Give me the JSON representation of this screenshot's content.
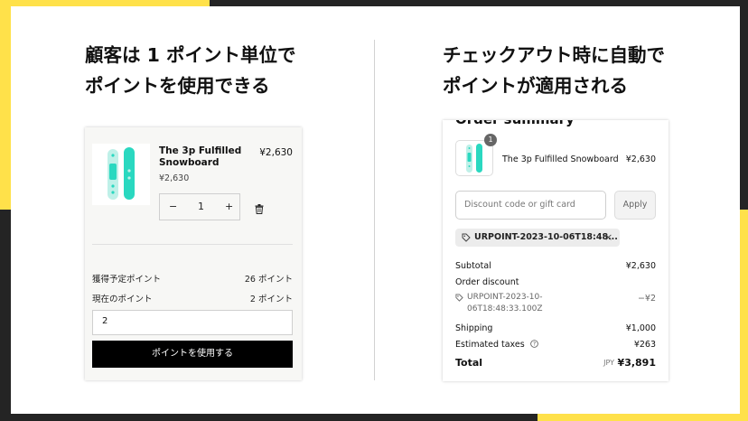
{
  "colors": {
    "accent": "#ffe14a",
    "dark_bg": "#242424",
    "board": "#2ad8c0",
    "button": "#000000"
  },
  "headings": {
    "left_line1": "顧客は 1 ポイント単位で",
    "left_line2": "ポイントを使用できる",
    "right_line1": "チェックアウト時に自動で",
    "right_line2": "ポイントが適用される"
  },
  "cart": {
    "product_title_line1": "The 3p Fulfilled",
    "product_title_line2": "Snowboard",
    "price": "¥2,630",
    "unit_price": "¥2,630",
    "quantity": "1",
    "minus": "−",
    "plus": "+",
    "points": [
      {
        "label": "獲得予定ポイント",
        "value": "26 ポイント"
      },
      {
        "label": "現在のポイント",
        "value": "2 ポイント"
      }
    ],
    "points_input_value": "2",
    "use_points_button": "ポイントを使用する"
  },
  "order": {
    "title": "Order summary",
    "item_count": "1",
    "product_name": "The 3p Fulfilled Snowboard",
    "product_price": "¥2,630",
    "discount_placeholder": "Discount code or gift card",
    "apply_label": "Apply",
    "applied_tag": "URPOINT-2023-10-06T18:48...",
    "subtotal_label": "Subtotal",
    "subtotal_value": "¥2,630",
    "order_discount_label": "Order discount",
    "discount_code_line1": "URPOINT-2023-10-",
    "discount_code_line2": "06T18:48:33.100Z",
    "discount_value": "−¥2",
    "shipping_label": "Shipping",
    "shipping_value": "¥1,000",
    "taxes_label": "Estimated taxes",
    "taxes_value": "¥263",
    "total_label": "Total",
    "total_currency": "JPY",
    "total_value": "¥3,891"
  }
}
